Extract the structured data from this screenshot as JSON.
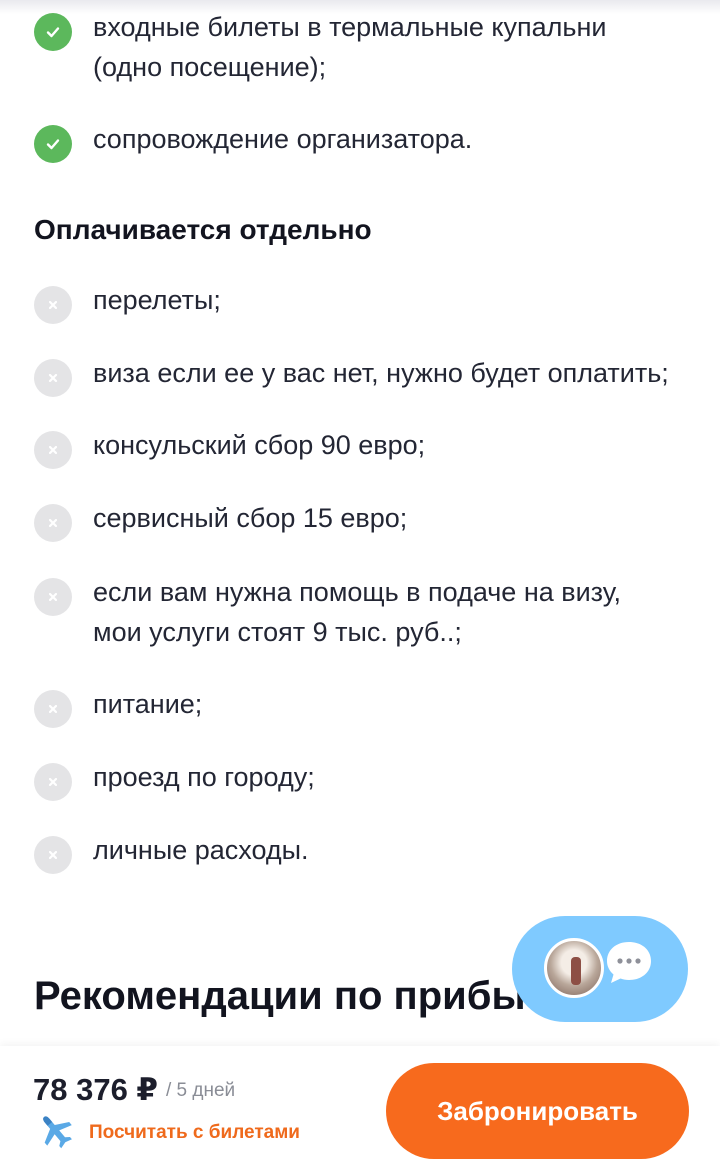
{
  "included": {
    "items": [
      "входные билеты в термальные купальни",
      "(одно посещение);",
      "сопровождение организатора."
    ]
  },
  "extra": {
    "title": "Оплачивается отдельно",
    "items": [
      "перелеты;",
      "виза если ее у вас нет, нужно будет оплатить;",
      "консульский сбор 90 евро;",
      "сервисный сбор 15 евро;",
      "если вам нужна помощь в подаче на визу,",
      "мои услуги стоят 9 тыс. руб..;",
      "питание;",
      "проезд по городу;",
      "личные расходы."
    ]
  },
  "recommend": {
    "title": "Рекомендации по прибыт"
  },
  "chat": {
    "avatar_icon": "guide-avatar",
    "bubble_icon": "chat-bubble-icon"
  },
  "footer": {
    "price": "78 376 ₽",
    "per": "/ 5 дней",
    "calc_label": "Посчитать с билетами",
    "book_label": "Забронировать"
  },
  "colors": {
    "accent": "#f76a1d",
    "included_check": "#5cb85c",
    "chat_bg": "#7fcaff"
  }
}
